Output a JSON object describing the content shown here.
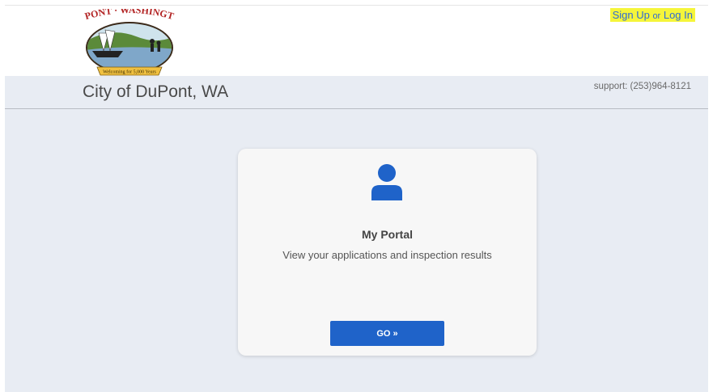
{
  "header": {
    "logo_top_text": "DUPONT · WASHINGTON",
    "logo_banner_text": "Welcoming for 5,000 Years",
    "sign_up_label": "Sign Up",
    "or_label": "or",
    "log_in_label": "Log In",
    "city_name": "City of DuPont, WA",
    "support_text": "support: (253)964-8121"
  },
  "portal_card": {
    "icon": "user-icon",
    "title": "My Portal",
    "description": "View your applications and inspection results",
    "button_label": "GO »"
  },
  "colors": {
    "accent": "#1f63c9",
    "highlight": "#f5f53a",
    "background": "#e8ecf3"
  }
}
